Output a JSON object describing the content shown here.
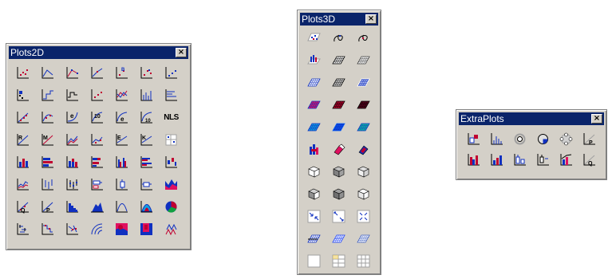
{
  "colors": {
    "titlebar": "#0a246a",
    "panel": "#d4d0c8",
    "blue": "#1030c0",
    "red": "#c00030",
    "magenta": "#e01060",
    "cyan": "#10a0e0",
    "gray3d": "#a0a0a0"
  },
  "plots2d": {
    "title": "Plots2D",
    "close": "×",
    "rows": [
      [
        "scatter-plot-icon",
        "line-plot-icon",
        "line-symbol-plot-icon",
        "line-series-icon",
        "scatter-ab-icon",
        "scatter-color-icon",
        "scatter-small-icon"
      ],
      [
        "scatter-block-icon",
        "step-plot-icon",
        "step-horizontal-icon",
        "dot-line-icon",
        "multi-line-icon",
        "vertical-drop-icon",
        "horizontal-drop-icon"
      ],
      [
        "linear-fit-icon",
        "polynomial-fit-icon",
        "exponential-fit-icon",
        "power-fit-icon",
        "log-fit-icon",
        "log10-fit-icon",
        "nls-fit-icon"
      ],
      [
        "r-squared-icon",
        "multiple-regression-icon",
        "spline-fit-icon",
        "smooth-fit-icon",
        "error-fit-icon",
        "k-fit-icon",
        "cross-grid-icon"
      ],
      [
        "bar-chart-icon",
        "horizontal-bar-icon",
        "stacked-bar-icon",
        "horizontal-stacked-icon",
        "grouped-bar-icon",
        "horizontal-grouped-icon",
        "floating-bar-icon"
      ],
      [
        "area-line-icon",
        "hi-lo-icon",
        "hi-lo-close-icon",
        "box-horizontal-icon",
        "box-plot-icon",
        "box-horizontal-plot-icon",
        "area-mountain-icon"
      ],
      [
        "q-q-plot-icon",
        "p-p-plot-icon",
        "histogram-icon",
        "filled-area-icon",
        "distribution-curve-icon",
        "fill-curve-icon",
        "pie-chart-icon"
      ],
      [
        "vector-plot-icon",
        "multi-step-icon",
        "vector-xy-icon",
        "polar-plot-icon",
        "contour-color-icon",
        "contour-fill-icon",
        "ternary-plot-icon"
      ]
    ],
    "nls_label": "NLS"
  },
  "plots3d": {
    "title": "Plots3D",
    "close": "×",
    "rows": [
      [
        "scatter3d-icon",
        "spiral3d-icon",
        "spiral3d-alt-icon"
      ],
      [
        "bar3d-icon",
        "wire-surface-icon",
        "wire-surface-alt-icon"
      ],
      [
        "mesh-surface-icon",
        "mesh-surface-dark-icon",
        "mesh-surface-filled-icon"
      ],
      [
        "color-surface-magenta-icon",
        "color-surface-red-icon",
        "color-surface-dark-icon"
      ],
      [
        "color-surface-cyan-icon",
        "color-surface-blue-icon",
        "color-surface-teal-icon"
      ],
      [
        "bar3d-stack-icon",
        "ribbon3d-icon",
        "ribbon3d-color-icon"
      ],
      [
        "cube-wire-icon",
        "cube-shaded-icon",
        "cube-outline-icon"
      ],
      [
        "cube-left-icon",
        "cube-shaded-alt-icon",
        "cube-outline-alt-icon"
      ],
      [
        "arrow-in-icon",
        "arrow-out-icon",
        "arrow-grid-icon"
      ],
      [
        "surface-slice-icon",
        "surface-double-icon",
        "surface-flat-icon"
      ],
      [
        "empty-grid-icon",
        "table-grid-icon",
        "full-grid-icon"
      ]
    ]
  },
  "extraplots": {
    "title": "ExtraPlots",
    "close": "×",
    "rows": [
      [
        "bar-xy-icon",
        "column-chart-icon",
        "circle-loop-icon",
        "circle-filled-icon",
        "flower-icon",
        "p-chart-icon"
      ],
      [
        "stacked-bar-red-icon",
        "bar-group-icon",
        "box-bar-icon",
        "error-bar-icon",
        "bar-line-icon",
        "q-chart-icon"
      ]
    ]
  }
}
